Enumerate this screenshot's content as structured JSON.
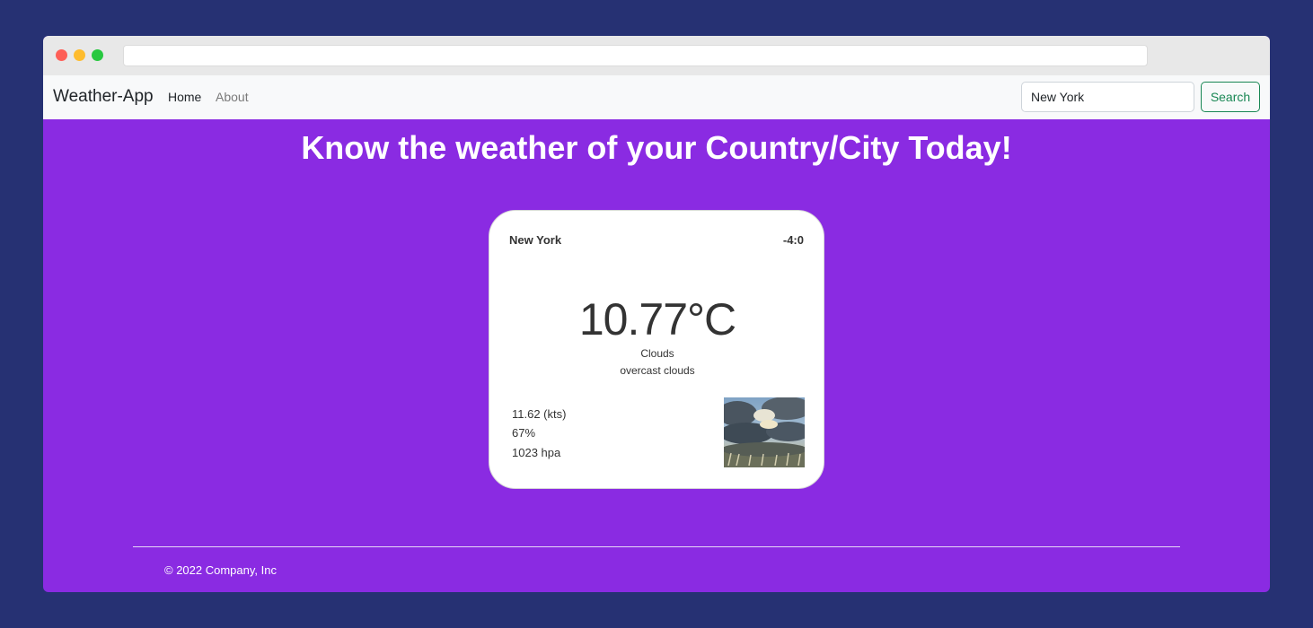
{
  "app": {
    "brand": "Weather-App",
    "nav": [
      {
        "label": "Home"
      },
      {
        "label": "About"
      }
    ],
    "search": {
      "value": "New York",
      "button_label": "Search"
    }
  },
  "main": {
    "headline": "Know the weather of your Country/City Today!"
  },
  "weather_card": {
    "city": "New York",
    "timezone": "-4:0",
    "temperature": "10.77°C",
    "condition": "Clouds",
    "description": "overcast clouds",
    "wind": "11.62 (kts)",
    "humidity": "67%",
    "pressure": "1023 hpa",
    "image_icon": "cloudy-sky-image"
  },
  "footer": {
    "copyright": "© 2022 Company, Inc"
  },
  "colors": {
    "page_background": "#263173",
    "content_background": "#8a2be2",
    "search_button": "#198754"
  }
}
